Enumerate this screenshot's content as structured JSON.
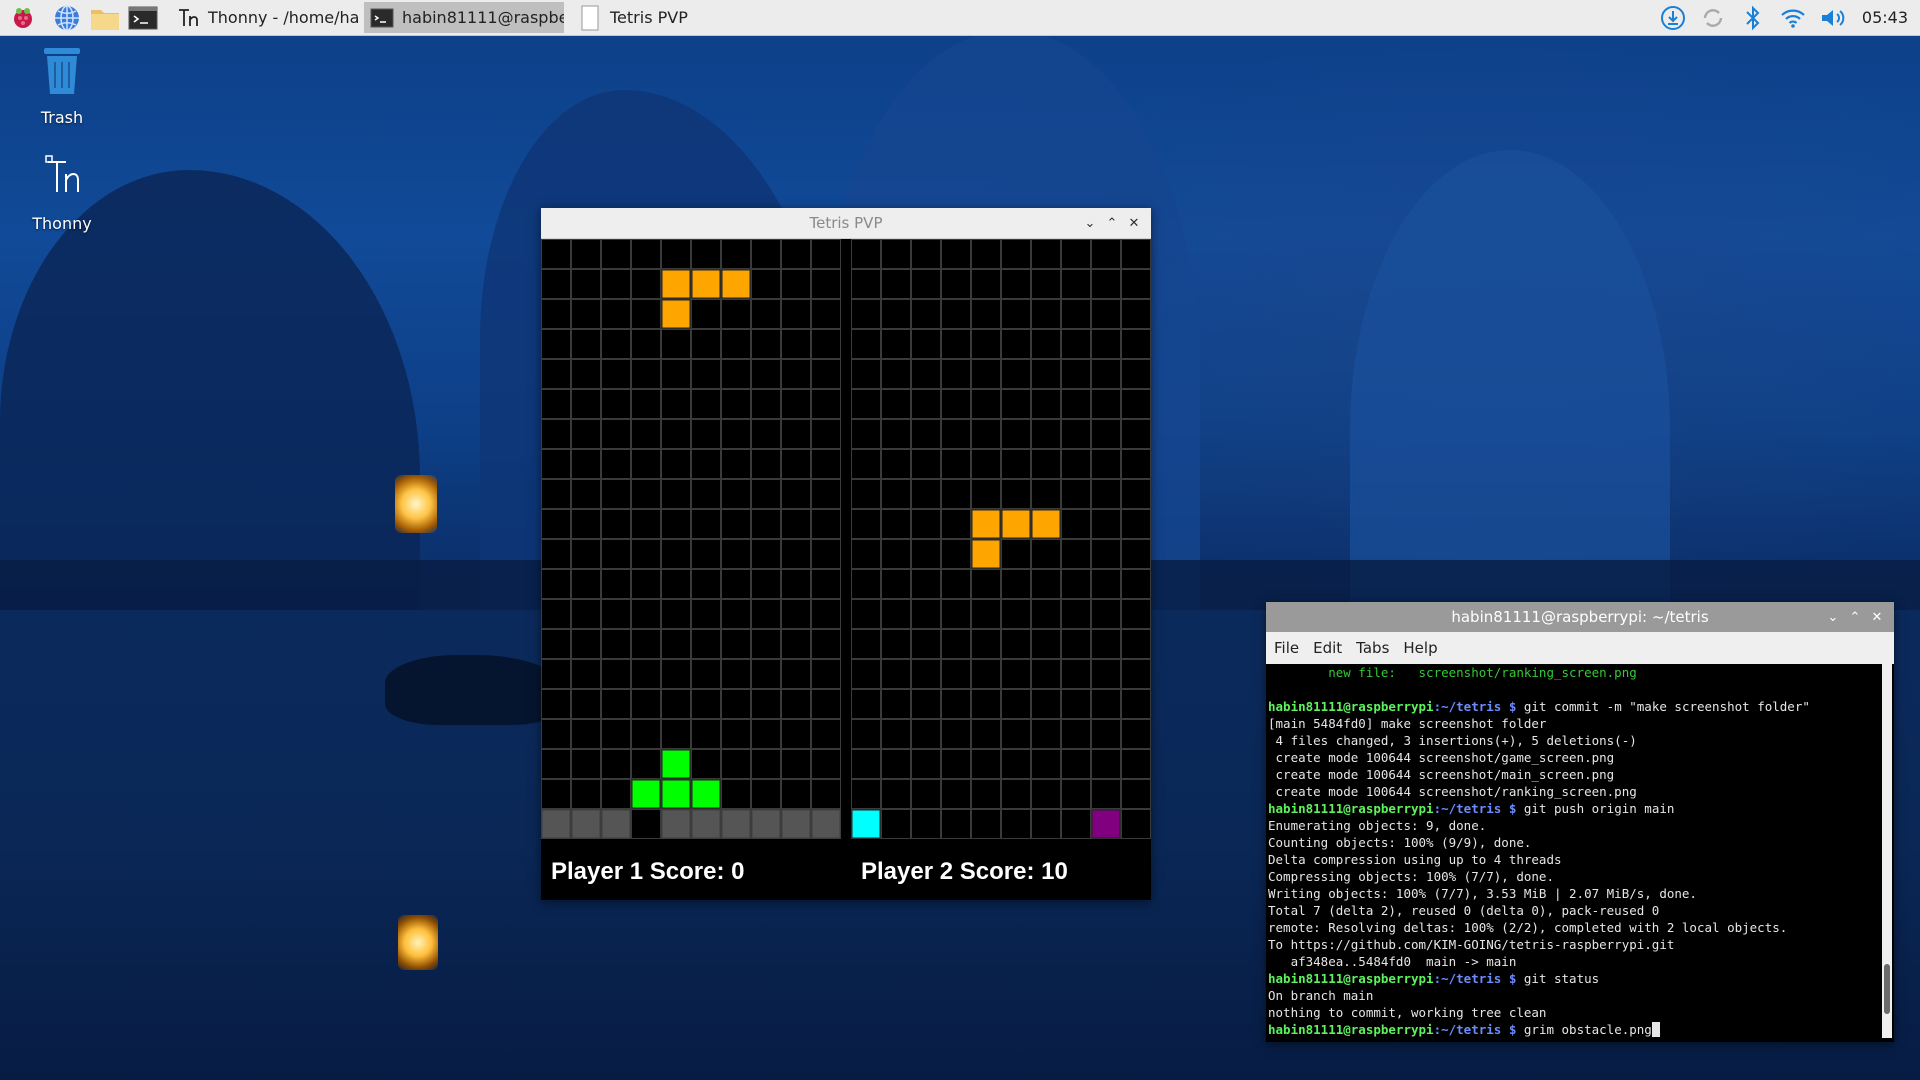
{
  "taskbar": {
    "apps": [
      {
        "name": "raspberry-menu-icon"
      },
      {
        "name": "web-browser-icon"
      },
      {
        "name": "file-manager-icon"
      },
      {
        "name": "terminal-icon"
      }
    ],
    "tasks": [
      {
        "label": "Thonny  -  /home/ha..",
        "icon": "thonny-icon",
        "active": false
      },
      {
        "label": "habin81111@raspbe...",
        "icon": "terminal-icon",
        "active": true
      },
      {
        "label": "Tetris PVP",
        "icon": "window-icon",
        "active": false
      }
    ],
    "clock": "05:43"
  },
  "desktop": {
    "icons": [
      {
        "label": "Trash"
      },
      {
        "label": "Thonny"
      }
    ]
  },
  "tetris": {
    "title": "Tetris PVP",
    "colors": {
      "orange": "#ffa500",
      "green": "#00ff00",
      "cyan": "#00ffff",
      "purple": "#800080",
      "gray": "#555555",
      "grid": "#3a3a3a"
    },
    "player1": {
      "score_text": "Player 1 Score: 0",
      "active_piece": [
        [
          4,
          1
        ],
        [
          5,
          1
        ],
        [
          6,
          1
        ],
        [
          4,
          2
        ]
      ],
      "locked": [
        {
          "c": 4,
          "r": 17,
          "color": "green"
        },
        {
          "c": 3,
          "r": 18,
          "color": "green"
        },
        {
          "c": 4,
          "r": 18,
          "color": "green"
        },
        {
          "c": 5,
          "r": 18,
          "color": "green"
        }
      ],
      "garbage_row": {
        "r": 19,
        "hole": 3
      }
    },
    "player2": {
      "score_text": "Player 2 Score: 10",
      "active_piece": [
        [
          4,
          9
        ],
        [
          5,
          9
        ],
        [
          6,
          9
        ],
        [
          4,
          10
        ]
      ],
      "locked": [
        {
          "c": 0,
          "r": 19,
          "color": "cyan"
        },
        {
          "c": 8,
          "r": 19,
          "color": "purple"
        }
      ]
    }
  },
  "terminal": {
    "title": "habin81111@raspberrypi: ~/tetris",
    "menu": [
      "File",
      "Edit",
      "Tabs",
      "Help"
    ],
    "prompt_user": "habin81111@raspberrypi",
    "prompt_path": ":~/tetris $",
    "lines": [
      {
        "type": "green",
        "text": "        new file:   screenshot/ranking_screen.png"
      },
      {
        "type": "out",
        "text": ""
      },
      {
        "type": "cmd",
        "text": " git commit -m \"make screenshot folder\""
      },
      {
        "type": "out",
        "text": "[main 5484fd0] make screenshot folder"
      },
      {
        "type": "out",
        "text": " 4 files changed, 3 insertions(+), 5 deletions(-)"
      },
      {
        "type": "out",
        "text": " create mode 100644 screenshot/game_screen.png"
      },
      {
        "type": "out",
        "text": " create mode 100644 screenshot/main_screen.png"
      },
      {
        "type": "out",
        "text": " create mode 100644 screenshot/ranking_screen.png"
      },
      {
        "type": "cmd",
        "text": " git push origin main"
      },
      {
        "type": "out",
        "text": "Enumerating objects: 9, done."
      },
      {
        "type": "out",
        "text": "Counting objects: 100% (9/9), done."
      },
      {
        "type": "out",
        "text": "Delta compression using up to 4 threads"
      },
      {
        "type": "out",
        "text": "Compressing objects: 100% (7/7), done."
      },
      {
        "type": "out",
        "text": "Writing objects: 100% (7/7), 3.53 MiB | 2.07 MiB/s, done."
      },
      {
        "type": "out",
        "text": "Total 7 (delta 2), reused 0 (delta 0), pack-reused 0"
      },
      {
        "type": "out",
        "text": "remote: Resolving deltas: 100% (2/2), completed with 2 local objects."
      },
      {
        "type": "out",
        "text": "To https://github.com/KIM-GOING/tetris-raspberrypi.git"
      },
      {
        "type": "out",
        "text": "   af348ea..5484fd0  main -> main"
      },
      {
        "type": "cmd",
        "text": " git status"
      },
      {
        "type": "out",
        "text": "On branch main"
      },
      {
        "type": "out",
        "text": "nothing to commit, working tree clean"
      },
      {
        "type": "cmd",
        "text": " grim obstacle.png",
        "cursor": true
      }
    ]
  }
}
